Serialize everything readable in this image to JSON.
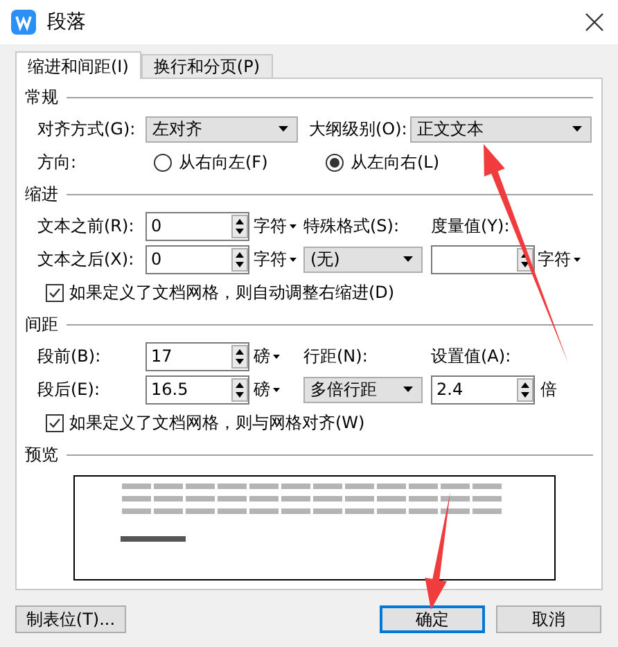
{
  "window": {
    "title": "段落"
  },
  "tabs": [
    {
      "label": "缩进和间距(I)",
      "selected": true
    },
    {
      "label": "换行和分页(P)",
      "selected": false
    }
  ],
  "general": {
    "heading": "常规",
    "alignment": {
      "label": "对齐方式(G):",
      "value": "左对齐"
    },
    "outline_level": {
      "label": "大纲级别(O):",
      "value": "正文文本"
    },
    "direction": {
      "label": "方向:",
      "options": [
        {
          "label": "从右向左(F)",
          "selected": false
        },
        {
          "label": "从左向右(L)",
          "selected": true
        }
      ]
    }
  },
  "indent": {
    "heading": "缩进",
    "before": {
      "label": "文本之前(R):",
      "value": "0",
      "unit": "字符"
    },
    "after": {
      "label": "文本之后(X):",
      "value": "0",
      "unit": "字符"
    },
    "special": {
      "label": "特殊格式(S):",
      "value": "(无)"
    },
    "metric": {
      "label": "度量值(Y):",
      "unit": "字符"
    },
    "auto_adjust": {
      "label": "如果定义了文档网格，则自动调整右缩进(D)",
      "checked": true
    }
  },
  "spacing": {
    "heading": "间距",
    "before": {
      "label": "段前(B):",
      "value": "17",
      "unit": "磅"
    },
    "after": {
      "label": "段后(E):",
      "value": "16.5",
      "unit": "磅"
    },
    "line_spacing": {
      "label": "行距(N):",
      "value": "多倍行距"
    },
    "at": {
      "label": "设置值(A):",
      "value": "2.4",
      "unit": "倍"
    },
    "snap_to_grid": {
      "label": "如果定义了文档网格，则与网格对齐(W)",
      "checked": true
    }
  },
  "preview": {
    "heading": "预览"
  },
  "buttons": [
    {
      "label": "制表位(T)...",
      "focused": false
    },
    {
      "label": "确定",
      "focused": true
    },
    {
      "label": "取消",
      "focused": false
    }
  ],
  "annotations": [
    {
      "kind": "arrow"
    },
    {
      "kind": "arrow"
    }
  ]
}
